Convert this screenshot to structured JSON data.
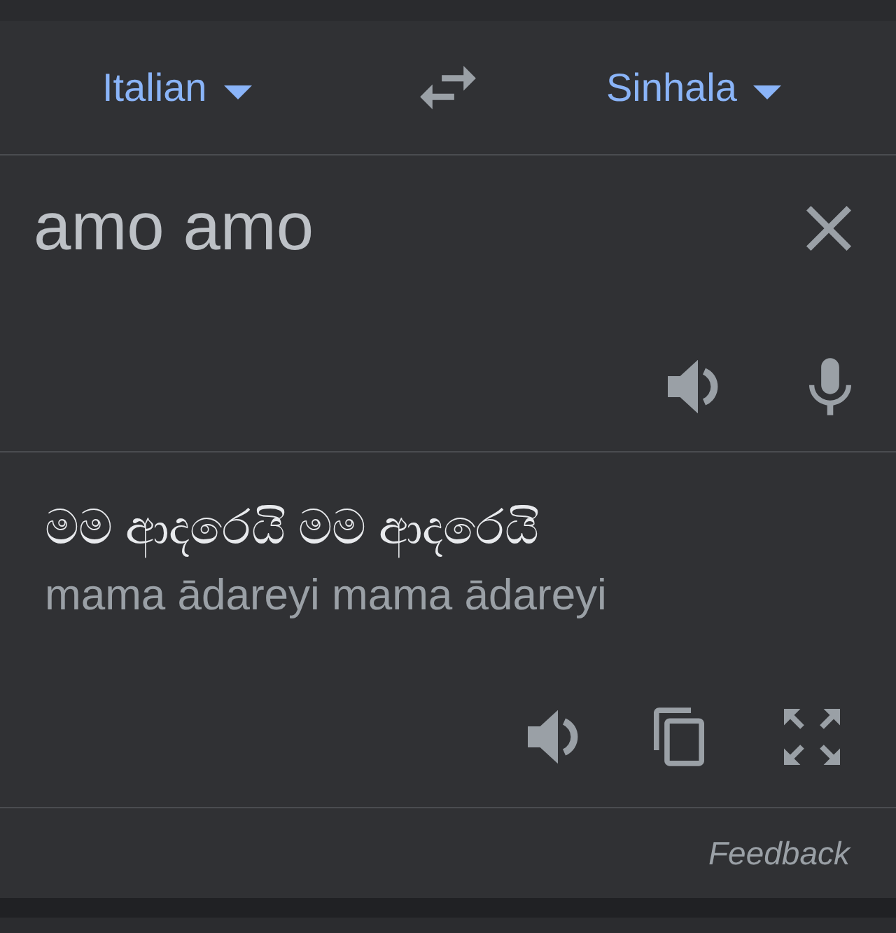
{
  "language_bar": {
    "source_language": "Italian",
    "target_language": "Sinhala"
  },
  "input": {
    "value": "amo amo"
  },
  "output": {
    "translation": "මම ආදරෙයි මම ආදරෙයි",
    "transliteration": "mama ādareyi mama ādareyi"
  },
  "footer": {
    "feedback": "Feedback"
  }
}
